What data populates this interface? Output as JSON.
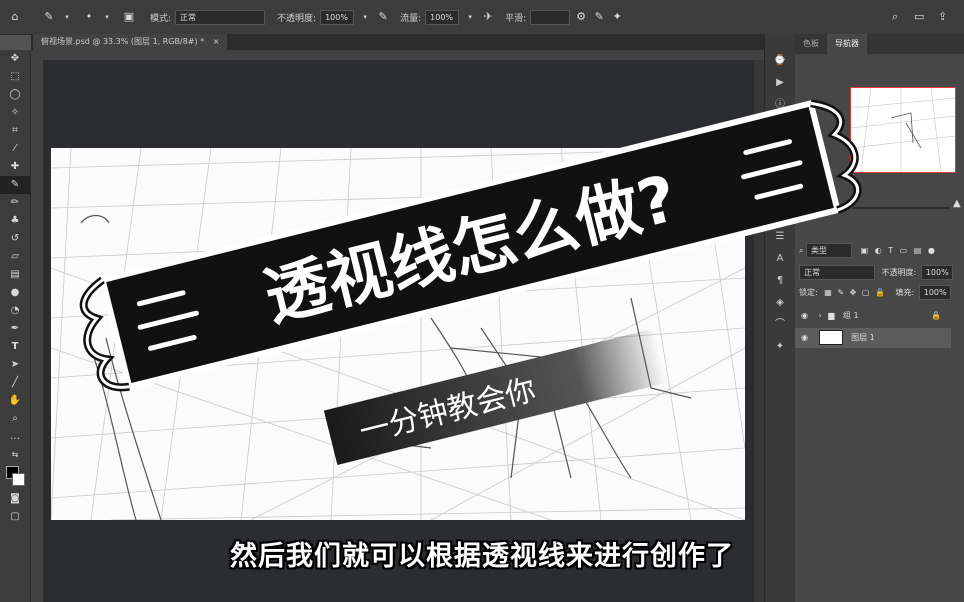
{
  "options_bar": {
    "mode_label": "模式:",
    "mode_value": "正常",
    "opacity_label": "不透明度:",
    "opacity_value": "100%",
    "flow_label": "流量:",
    "flow_value": "100%",
    "smoothing_label": "平滑:"
  },
  "document_tab": {
    "title": "俯视场景.psd @ 33.3% (图层 1, RGB/8#) *"
  },
  "panel": {
    "tabs": [
      "色板",
      "导航器"
    ],
    "active_tab": "导航器"
  },
  "layers": {
    "filter_label": "类型",
    "blend_mode": "正常",
    "opacity_label": "不透明度:",
    "opacity_value": "100%",
    "lock_label": "锁定:",
    "fill_label": "填充:",
    "fill_value": "100%",
    "items": [
      {
        "name": "组 1",
        "type": "group"
      },
      {
        "name": "图层 1",
        "type": "layer"
      }
    ]
  },
  "overlay": {
    "title": "透视线怎么做?",
    "subtitle_banner": "一分钟教会你",
    "caption": "然后我们就可以根据透视线来进行创作了"
  },
  "colors": {
    "accent_red": "#e03b3b",
    "app_dark": "#3c3c3c",
    "canvas_bg": "#2b2d31"
  }
}
